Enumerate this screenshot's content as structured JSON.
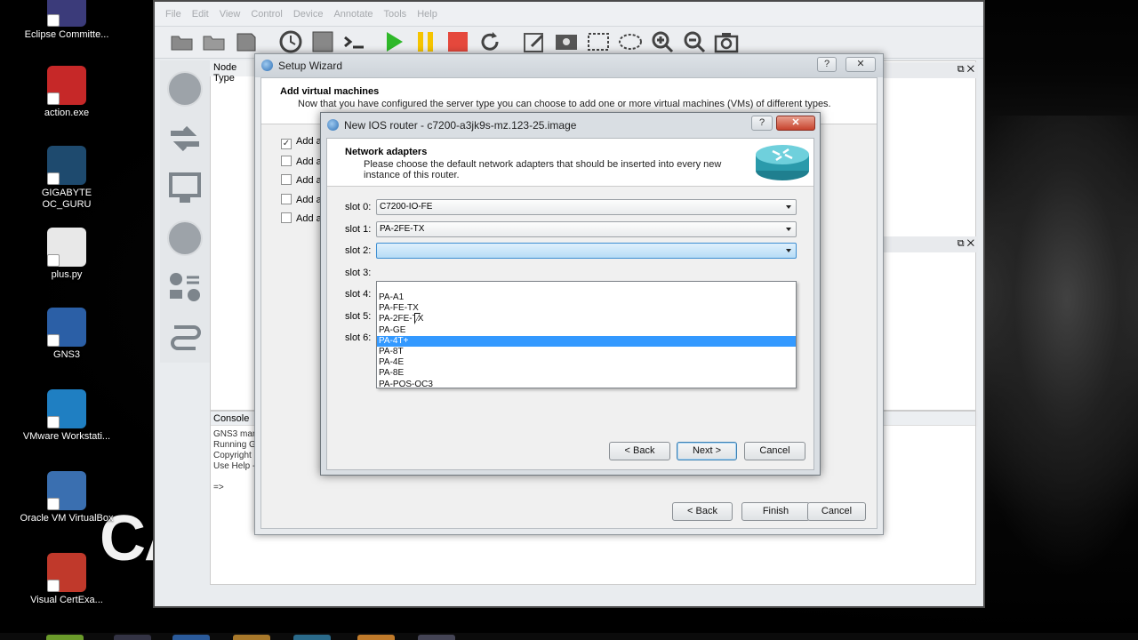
{
  "desktop": {
    "icons": [
      {
        "label": "Eclipse Committe...",
        "icon": "eclipse-icon",
        "color": "#3b3b7a"
      },
      {
        "label": "action.exe",
        "icon": "action-exe-icon",
        "color": "#c62828"
      },
      {
        "label": "GIGABYTE OC_GURU",
        "icon": "gigabyte-icon",
        "color": "#1e4a6e"
      },
      {
        "label": "plus.py",
        "icon": "python-file-icon",
        "color": "#e8e8e8"
      },
      {
        "label": "GNS3",
        "icon": "gns3-icon",
        "color": "#2b5fa6"
      },
      {
        "label": "VMware Workstati...",
        "icon": "vmware-icon",
        "color": "#1f7fc2"
      },
      {
        "label": "Oracle VM VirtualBox",
        "icon": "virtualbox-icon",
        "color": "#3a6fb0"
      },
      {
        "label": "Visual CertExa...",
        "icon": "visual-certexam-icon",
        "color": "#c0392b"
      }
    ],
    "background_logo": "CA"
  },
  "main_window": {
    "menu": [
      "File",
      "Edit",
      "View",
      "Control",
      "Device",
      "Annotate",
      "Tools",
      "Help"
    ],
    "node_types_title": "Node Type",
    "console_title": "Console",
    "console_lines": [
      "GNS3 mana",
      "Running GN",
      "Copyright",
      "Use Help -",
      "",
      "=>"
    ]
  },
  "setup_wizard": {
    "title": "Setup Wizard",
    "heading": "Add virtual machines",
    "subheading": "Now that you have configured the server type you can choose to add one or more virtual machines (VMs) of different types.",
    "options": [
      {
        "label": "Add a",
        "checked": true
      },
      {
        "label": "Add a",
        "checked": false
      },
      {
        "label": "Add a",
        "checked": false
      },
      {
        "label": "Add a",
        "checked": false
      },
      {
        "label": "Add a",
        "checked": false
      }
    ],
    "back_label": "< Back",
    "finish_label": "Finish",
    "cancel_label": "Cancel",
    "help_glyph": "?",
    "close_glyph": "✕"
  },
  "ios_dialog": {
    "title": "New IOS router - c7200-a3jk9s-mz.123-25.image",
    "heading": "Network adapters",
    "subheading": "Please choose the default network adapters that should be inserted into every new instance of this router.",
    "slots": [
      {
        "label": "slot 0:",
        "value": "C7200-IO-FE"
      },
      {
        "label": "slot 1:",
        "value": "PA-2FE-TX"
      },
      {
        "label": "slot 2:",
        "value": ""
      },
      {
        "label": "slot 3:",
        "value": ""
      },
      {
        "label": "slot 4:",
        "value": ""
      },
      {
        "label": "slot 5:",
        "value": ""
      },
      {
        "label": "slot 6:",
        "value": ""
      }
    ],
    "dropdown_options": [
      "PA-A1",
      "PA-FE-TX",
      "PA-2FE-TX",
      "PA-GE",
      "PA-4T+",
      "PA-8T",
      "PA-4E",
      "PA-8E",
      "PA-POS-OC3"
    ],
    "highlighted_option": "PA-4T+",
    "back_label": "< Back",
    "next_label": "Next >",
    "cancel_label": "Cancel",
    "help_glyph": "?",
    "close_glyph": "✕"
  },
  "colors": {
    "selection": "#3399ff",
    "close_button": "#c7432d"
  }
}
